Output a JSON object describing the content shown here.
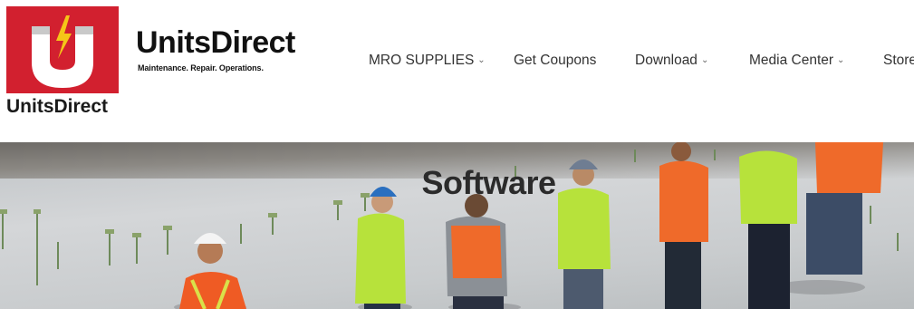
{
  "brand": {
    "logo_icon": "magnet-lightning-icon",
    "name": "UnitsDirect",
    "tagline": "Maintenance. Repair. Operations.",
    "site_title": "UnitsDirect",
    "accent_color": "#d2202f"
  },
  "nav": {
    "items": [
      {
        "label": "MRO SUPPLIES",
        "has_dropdown": true
      },
      {
        "label": "Get Coupons",
        "has_dropdown": false
      },
      {
        "label": "Download",
        "has_dropdown": true
      },
      {
        "label": "Media Center",
        "has_dropdown": true
      },
      {
        "label": "Store",
        "has_dropdown": false
      }
    ],
    "dropdown_icon": "chevron-down-icon"
  },
  "hero": {
    "title": "Software",
    "image": "construction-workers-photo"
  }
}
